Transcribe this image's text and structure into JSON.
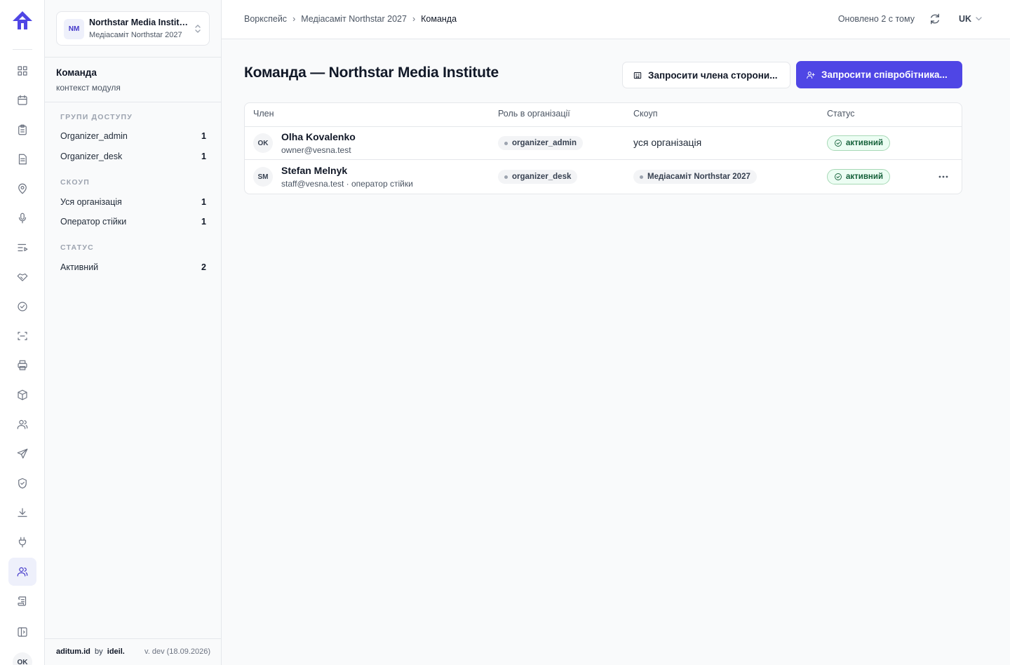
{
  "colors": {
    "accent": "#4f46e5",
    "active_rail_bg": "#eef0fb",
    "status_green": "#15613a"
  },
  "rail": {
    "icons": [
      "dashboard-icon",
      "calendar-icon",
      "clipboard-icon",
      "document-icon",
      "map-pin-icon",
      "microphone-icon",
      "list-play-icon",
      "handshake-icon",
      "check-circle-icon",
      "scan-icon",
      "printer-icon",
      "box-icon",
      "users-icon",
      "send-icon",
      "shield-check-icon",
      "download-icon",
      "plug-icon",
      "team-icon",
      "scroll-icon",
      "sidebar-toggle-icon"
    ],
    "active": "team-icon",
    "user_initials": "OK"
  },
  "org": {
    "initials": "NM",
    "name": "Northstar Media Institute",
    "event": "Медіасаміт Northstar 2027"
  },
  "module": {
    "title": "Команда",
    "subtitle": "контекст модуля"
  },
  "filters": {
    "access_groups": {
      "heading": "Групи доступу",
      "items": [
        {
          "label": "Organizer_admin",
          "count": "1"
        },
        {
          "label": "Organizer_desk",
          "count": "1"
        }
      ]
    },
    "scope": {
      "heading": "Скоуп",
      "items": [
        {
          "label": "Уся організація",
          "count": "1"
        },
        {
          "label": "Оператор стійки",
          "count": "1"
        }
      ]
    },
    "status": {
      "heading": "Статус",
      "items": [
        {
          "label": "Активний",
          "count": "2"
        }
      ]
    }
  },
  "footer": {
    "brand": "aditum.id",
    "by": "by",
    "company": "ideil.",
    "version": "v. dev (18.09.2026)"
  },
  "topbar": {
    "breadcrumbs": [
      "Воркспейс",
      "Медіасаміт Northstar 2027",
      "Команда"
    ],
    "separator": "›",
    "updated": "Оновлено 2 с тому",
    "language": "UK"
  },
  "page": {
    "title": "Команда — Northstar Media Institute",
    "invite_external_label": "Запросити члена сторони...",
    "invite_staff_label": "Запросити співробітника..."
  },
  "table": {
    "columns": [
      "Член",
      "Роль в організації",
      "Скоуп",
      "Статус"
    ],
    "rows": [
      {
        "initials": "OK",
        "name": "Olha Kovalenko",
        "email": "owner@vesna.test",
        "role": "organizer_admin",
        "scope": "уся організація",
        "scope_is_pill": false,
        "status": "активний",
        "has_menu": false
      },
      {
        "initials": "SM",
        "name": "Stefan Melnyk",
        "email": "staff@vesna.test · оператор стійки",
        "role": "organizer_desk",
        "scope": "Медіасаміт Northstar 2027",
        "scope_is_pill": true,
        "status": "активний",
        "has_menu": true
      }
    ]
  }
}
